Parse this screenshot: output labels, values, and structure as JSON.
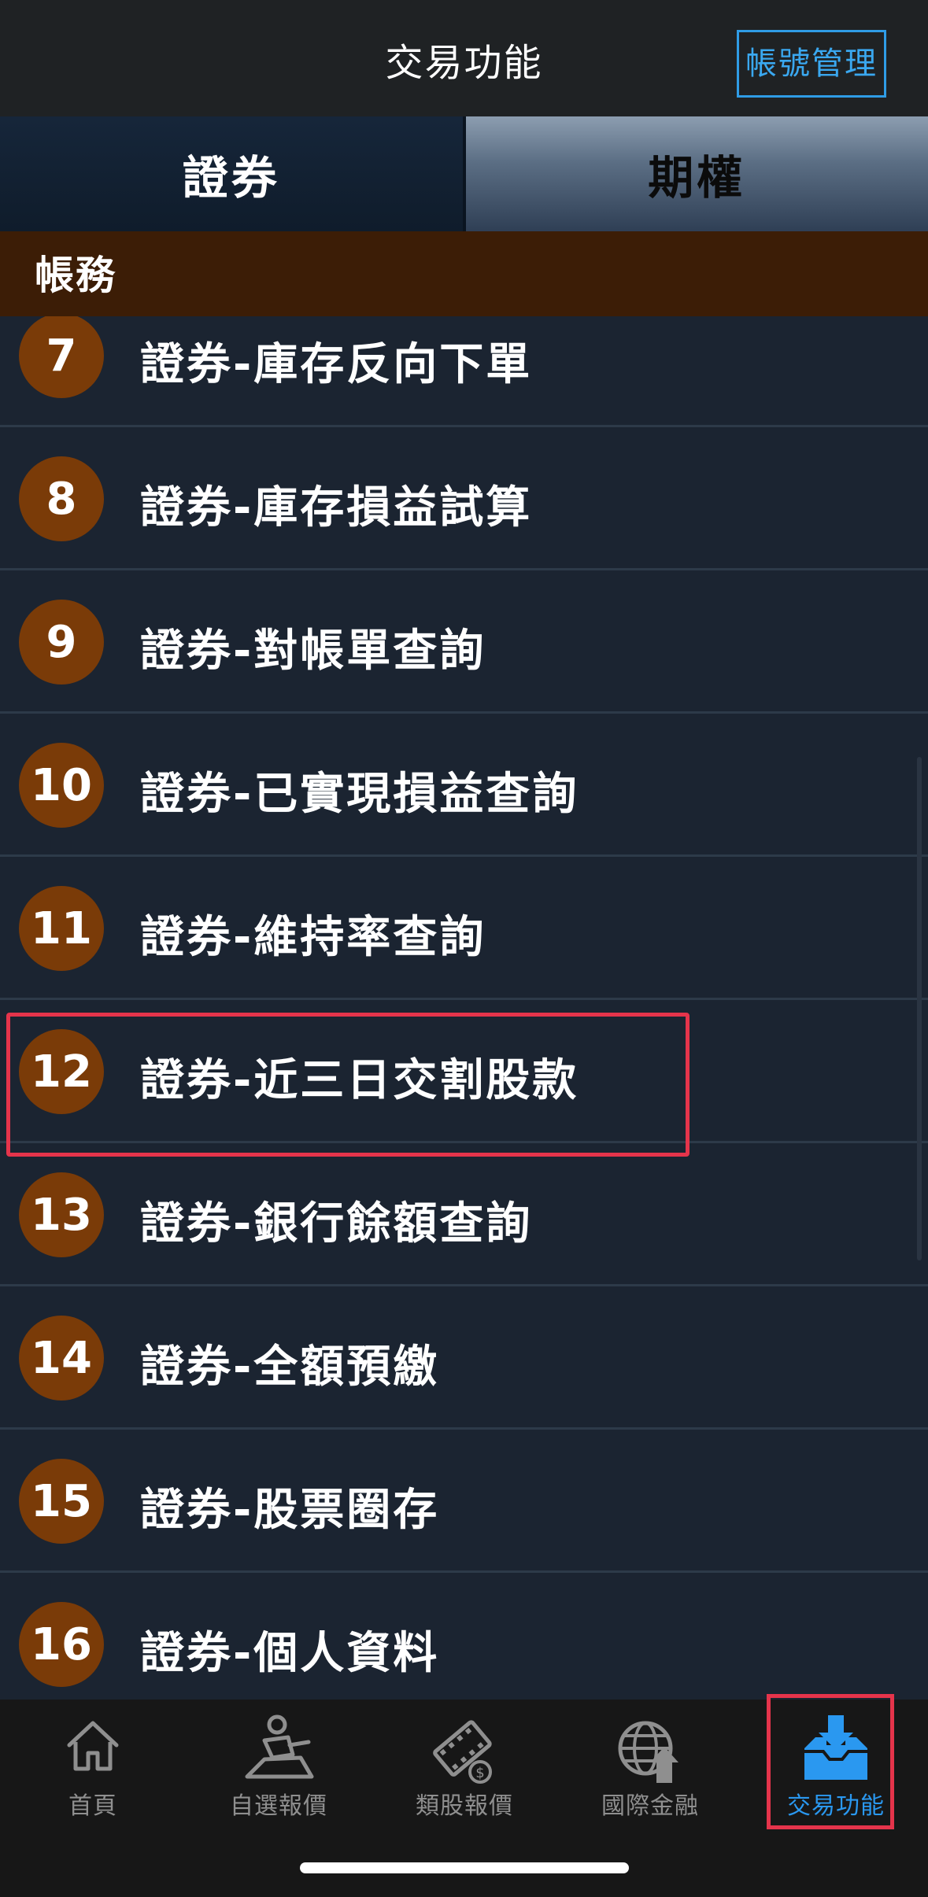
{
  "header": {
    "title": "交易功能",
    "account_button": "帳號管理"
  },
  "tabs": [
    {
      "label": "證券",
      "active": true
    },
    {
      "label": "期權",
      "active": false
    }
  ],
  "section": {
    "title": "帳務"
  },
  "list": {
    "items": [
      {
        "number": "7",
        "label": "證券-庫存反向下單"
      },
      {
        "number": "8",
        "label": "證券-庫存損益試算"
      },
      {
        "number": "9",
        "label": "證券-對帳單查詢"
      },
      {
        "number": "10",
        "label": "證券-已實現損益查詢"
      },
      {
        "number": "11",
        "label": "證券-維持率查詢"
      },
      {
        "number": "12",
        "label": "證券-近三日交割股款",
        "highlighted": true
      },
      {
        "number": "13",
        "label": "證券-銀行餘額查詢"
      },
      {
        "number": "14",
        "label": "證券-全額預繳"
      },
      {
        "number": "15",
        "label": "證券-股票圈存"
      },
      {
        "number": "16",
        "label": "證券-個人資料"
      }
    ]
  },
  "bottom_nav": {
    "items": [
      {
        "label": "首頁",
        "icon": "home-icon"
      },
      {
        "label": "自選報價",
        "icon": "person-desk-icon"
      },
      {
        "label": "類股報價",
        "icon": "film-coin-icon"
      },
      {
        "label": "國際金融",
        "icon": "globe-arrow-icon"
      },
      {
        "label": "交易功能",
        "icon": "tray-download-icon",
        "active": true
      }
    ]
  },
  "colors": {
    "accent_blue": "#2a98f0",
    "highlight_red": "#e5344b",
    "badge_brown": "#7a3b08",
    "section_brown": "#3c1d06",
    "list_bg": "#1b2431"
  }
}
